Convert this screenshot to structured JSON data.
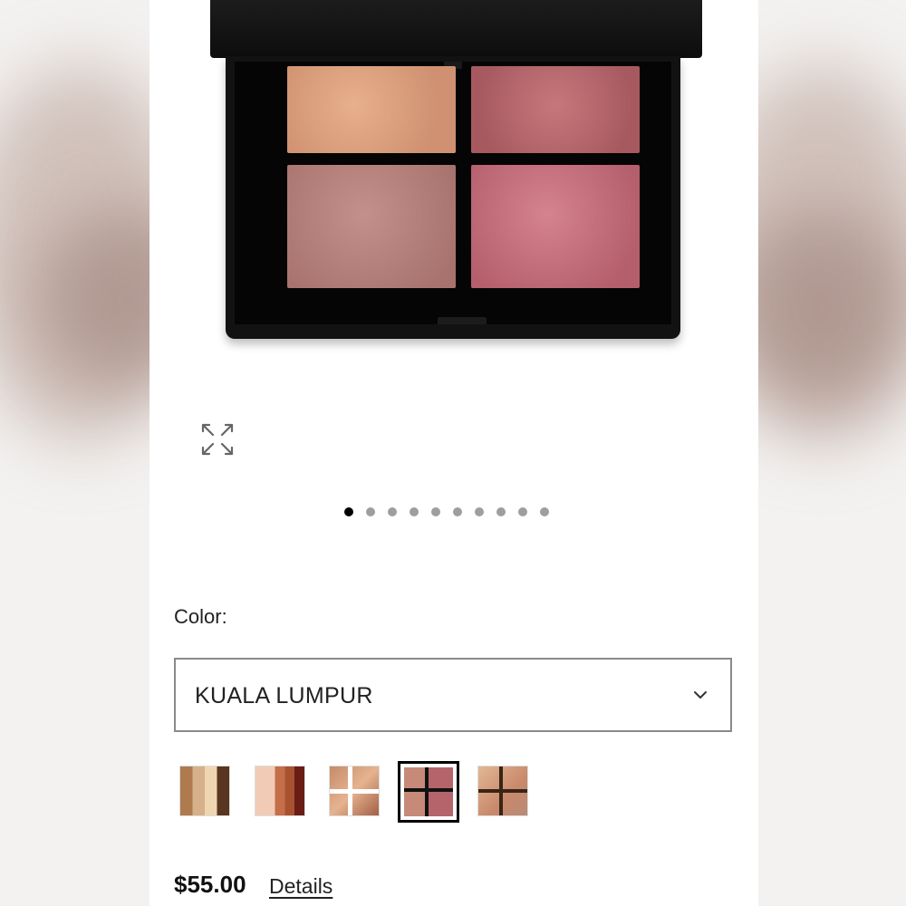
{
  "product": {
    "image_alt": "eyeshadow-quad-palette",
    "pan_colors": [
      "#d9a07e",
      "#b5676c",
      "#b5817c",
      "#c56f7c"
    ],
    "carousel": {
      "total": 10,
      "active_index": 0
    }
  },
  "color_selector": {
    "label": "Color:",
    "selected_value": "KUALA LUMPUR",
    "swatches": [
      {
        "name": "swatch-1",
        "selected": false
      },
      {
        "name": "swatch-2",
        "selected": false
      },
      {
        "name": "swatch-3",
        "selected": false
      },
      {
        "name": "swatch-4",
        "selected": true
      },
      {
        "name": "swatch-5",
        "selected": false
      }
    ]
  },
  "pricing": {
    "price": "$55.00",
    "details_link": "Details"
  },
  "icons": {
    "expand": "expand-icon",
    "dropdown": "chevron-down-icon"
  }
}
